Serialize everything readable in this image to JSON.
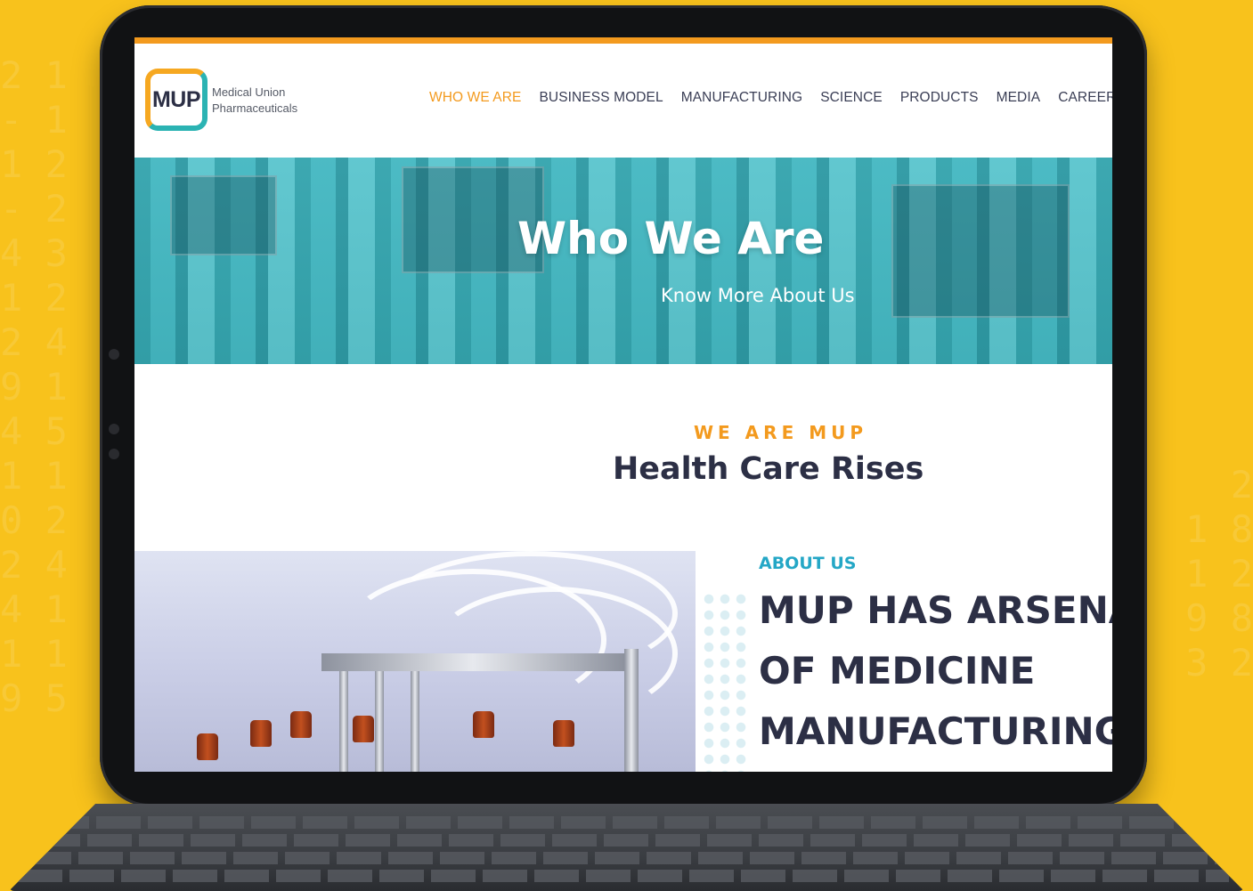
{
  "logo": {
    "mark": "MUP",
    "name_line1": "Medical Union",
    "name_line2": "Pharmaceuticals"
  },
  "nav": {
    "items": [
      {
        "label": "WHO WE ARE",
        "active": true
      },
      {
        "label": "BUSINESS MODEL",
        "active": false
      },
      {
        "label": "MANUFACTURING",
        "active": false
      },
      {
        "label": "SCIENCE",
        "active": false
      },
      {
        "label": "PRODUCTS",
        "active": false
      },
      {
        "label": "MEDIA",
        "active": false
      },
      {
        "label": "CAREER",
        "active": false
      }
    ]
  },
  "hero": {
    "title": "Who We Are",
    "subtitle": "Know More About Us"
  },
  "intro": {
    "eyebrow": "WE ARE MUP",
    "title": "Health Care Rises"
  },
  "about": {
    "label": "ABOUT US",
    "heading_line1": "MUP HAS ARSENA",
    "heading_line2": "OF MEDICINE",
    "heading_line3": "MANUFACTURING"
  },
  "colors": {
    "background": "#f8c21c",
    "accent": "#f39a1e",
    "teal": "#24a7c6",
    "navy": "#2c2f45"
  }
}
